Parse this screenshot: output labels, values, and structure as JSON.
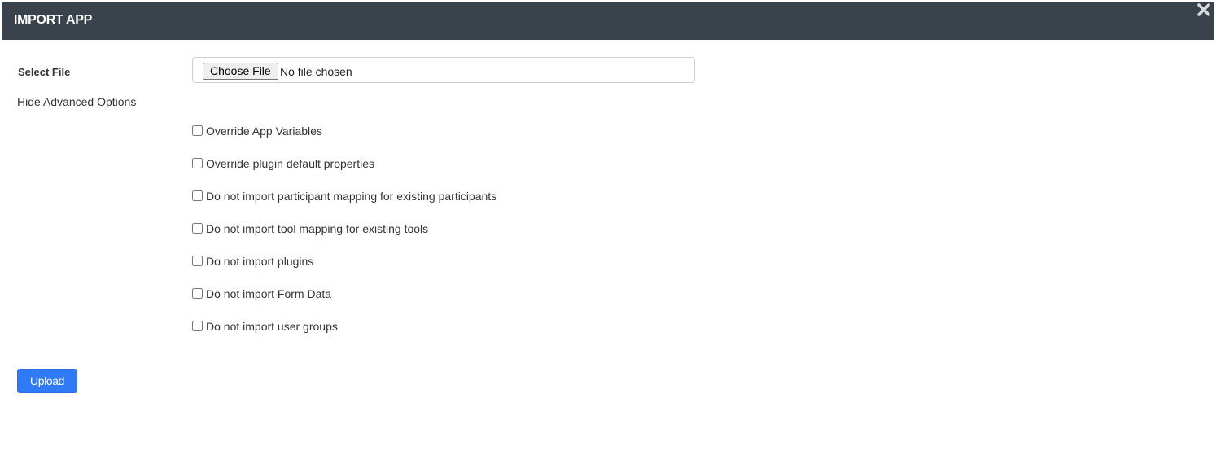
{
  "dialog": {
    "title": "IMPORT APP",
    "close_icon": "close-icon"
  },
  "file": {
    "label": "Select File",
    "button_label": "Choose File",
    "status": "No file chosen"
  },
  "advanced": {
    "toggle_label": "Hide Advanced Options"
  },
  "options": [
    {
      "label": "Override App Variables",
      "checked": false
    },
    {
      "label": "Override plugin default properties",
      "checked": false
    },
    {
      "label": "Do not import participant mapping for existing participants",
      "checked": false
    },
    {
      "label": "Do not import tool mapping for existing tools",
      "checked": false
    },
    {
      "label": "Do not import plugins",
      "checked": false
    },
    {
      "label": "Do not import Form Data",
      "checked": false
    },
    {
      "label": "Do not import user groups",
      "checked": false
    }
  ],
  "actions": {
    "upload_label": "Upload"
  },
  "colors": {
    "title_bar": "#3a424b",
    "accent": "#2f7af5"
  }
}
